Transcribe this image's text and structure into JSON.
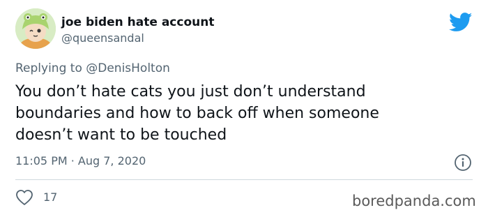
{
  "author": {
    "display_name": "joe biden hate account",
    "handle": "@queensandal",
    "avatar_icon": "frog-hat-avatar-icon"
  },
  "reply": {
    "prefix": "Replying to ",
    "mention": "@DenisHolton"
  },
  "tweet_text": "You don’t hate cats you just don’t understand\nboundaries and how to back off when someone\ndoesn’t want to be touched",
  "timestamp": "11:05 PM · Aug 7, 2020",
  "likes": {
    "count": "17",
    "icon": "heart-icon"
  },
  "icons": {
    "brand": "twitter-bird-icon",
    "info": "info-icon"
  },
  "watermark": "boredpanda.com",
  "colors": {
    "twitter_blue": "#1d9bf0",
    "text_primary": "#0f1419",
    "text_secondary": "#536471",
    "divider": "#cfd9de"
  }
}
